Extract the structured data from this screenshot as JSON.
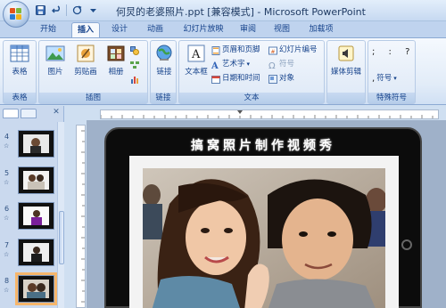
{
  "window": {
    "title": "何炅的老婆照片.ppt [兼容模式] - Microsoft PowerPoint"
  },
  "qat": {
    "icons": [
      "save-icon",
      "undo-icon",
      "redo-icon",
      "dropdown-icon"
    ]
  },
  "tabs": [
    {
      "label": "开始",
      "active": false
    },
    {
      "label": "插入",
      "active": true
    },
    {
      "label": "设计",
      "active": false
    },
    {
      "label": "动画",
      "active": false
    },
    {
      "label": "幻灯片放映",
      "active": false
    },
    {
      "label": "审阅",
      "active": false
    },
    {
      "label": "视图",
      "active": false
    },
    {
      "label": "加载项",
      "active": false
    }
  ],
  "ribbon": {
    "groups": {
      "table": {
        "label": "表格",
        "buttons": [
          "表格"
        ]
      },
      "illustrations": {
        "label": "插图",
        "buttons": [
          "图片",
          "剪贴画",
          "相册"
        ]
      },
      "links": {
        "label": "链接",
        "buttons": [
          "链接"
        ]
      },
      "text": {
        "label": "文本",
        "big": "文本框",
        "rows": [
          "页眉和页脚",
          "幻灯片编号",
          "艺术字",
          "符号",
          "日期和时间",
          "对象"
        ]
      },
      "media": {
        "label": "",
        "buttons": [
          "媒体剪辑"
        ]
      },
      "special": {
        "label": "特殊符号",
        "symbols": "; : ?",
        "button": "符号"
      }
    }
  },
  "slides_panel": {
    "numbers": [
      "4",
      "5",
      "6",
      "7",
      "8"
    ],
    "selected": "8"
  },
  "slide": {
    "title": "搞窝照片制作视频秀"
  },
  "colors": {
    "ribbon_bg": "#e2ecf8",
    "accent": "#15428b",
    "selected_thumb": "#f6b66b"
  }
}
